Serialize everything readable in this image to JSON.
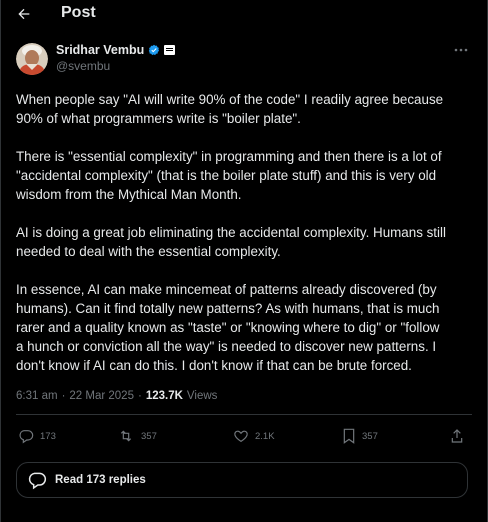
{
  "header": {
    "title": "Post",
    "back_icon": "arrow-left-icon"
  },
  "author": {
    "name": "Sridhar Vembu",
    "handle": "@svembu",
    "verified_color": "#1d9bf0",
    "avatar_icon": "user-avatar"
  },
  "post": {
    "paragraphs": [
      "When people say \"AI will write 90% of the code\" I readily agree because\n90% of what programmers write is \"boiler plate\".",
      "There is \"essential complexity\" in programming and then there is a lot of\n\"accidental complexity\" (that is the boiler plate stuff) and this is very old\nwisdom from the Mythical Man Month.",
      "AI is doing a great job eliminating the accidental complexity. Humans still\nneeded to deal with the essential complexity.",
      "In essence, AI can make mincemeat of patterns already discovered (by\nhumans). Can it find totally new patterns? As with humans, that is much\nrarer and a quality known as \"taste\" or \"knowing where to dig\" or \"follow\na hunch or conviction all the way\" is needed to discover new patterns. I\ndon't know if AI can do this. I don't know if that can be brute forced."
    ],
    "time": "6:31 am",
    "separator": "·",
    "date": "22 Mar 2025",
    "views_count": "123.7K",
    "views_label": "Views"
  },
  "actions": {
    "reply_count": "173",
    "repost_count": "357",
    "like_count": "2.1K",
    "bookmark_count": "357"
  },
  "replies_button": {
    "label": "Read 173 replies"
  },
  "colors": {
    "background": "#000000",
    "text": "#e7e9ea",
    "muted": "#71767b",
    "border": "#2f3336",
    "accent": "#1d9bf0"
  }
}
